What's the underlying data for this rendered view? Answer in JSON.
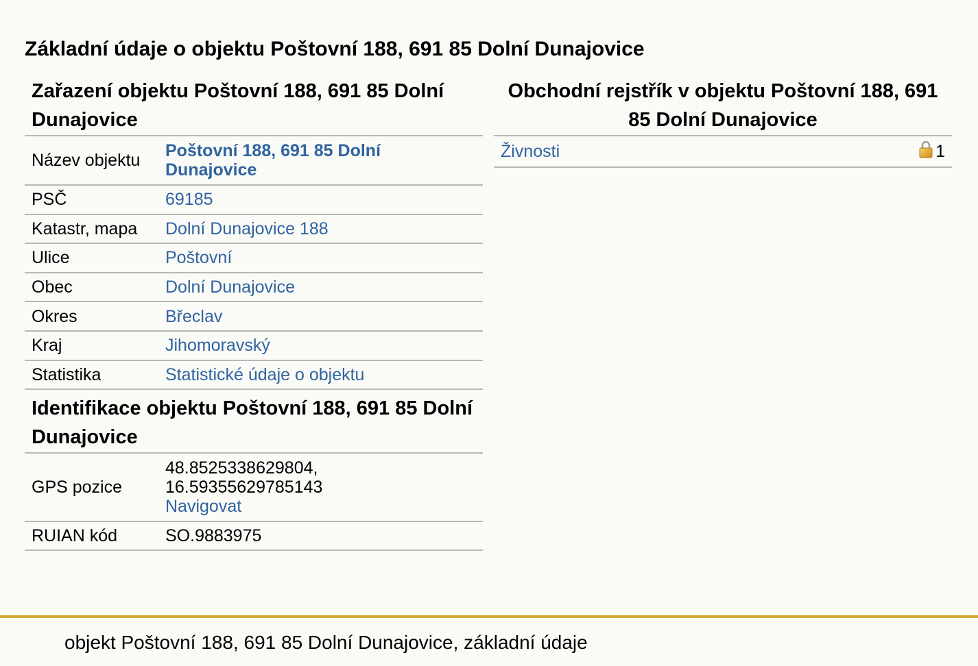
{
  "page_title": "Základní údaje o objektu Poštovní 188, 691 85 Dolní Dunajovice",
  "classification": {
    "heading": "Zařazení objektu Poštovní 188, 691 85 Dolní Dunajovice",
    "rows": [
      {
        "label": "Název objektu",
        "value": "Poštovní 188, 691 85 Dolní Dunajovice"
      },
      {
        "label": "PSČ",
        "value": "69185"
      },
      {
        "label": "Katastr, mapa",
        "value": "Dolní Dunajovice 188"
      },
      {
        "label": "Ulice",
        "value": "Poštovní"
      },
      {
        "label": "Obec",
        "value": "Dolní Dunajovice"
      },
      {
        "label": "Okres",
        "value": "Břeclav"
      },
      {
        "label": "Kraj",
        "value": "Jihomoravský"
      },
      {
        "label": "Statistika",
        "value": "Statistické údaje o objektu"
      }
    ]
  },
  "identification": {
    "heading": "Identifikace objektu Poštovní 188, 691 85 Dolní Dunajovice",
    "gps_label": "GPS pozice",
    "gps_lat": "48.8525338629804,",
    "gps_lon": "16.59355629785143",
    "navigate_label": "Navigovat",
    "ruian_label": "RUIAN kód",
    "ruian_value": "SO.9883975"
  },
  "business_register": {
    "heading": "Obchodní rejstřík v objektu Poštovní 188, 691 85 Dolní Dunajovice",
    "items": [
      {
        "label": "Živnosti",
        "count": "1",
        "icon": "lock-icon"
      }
    ]
  },
  "footer": {
    "text": "objekt Poštovní 188, 691 85 Dolní Dunajovice, základní údaje",
    "accent_color": "#d4a935"
  },
  "colors": {
    "link": "#2f64a0",
    "background": "#fafaf7",
    "divider": "#b7b7b7"
  }
}
